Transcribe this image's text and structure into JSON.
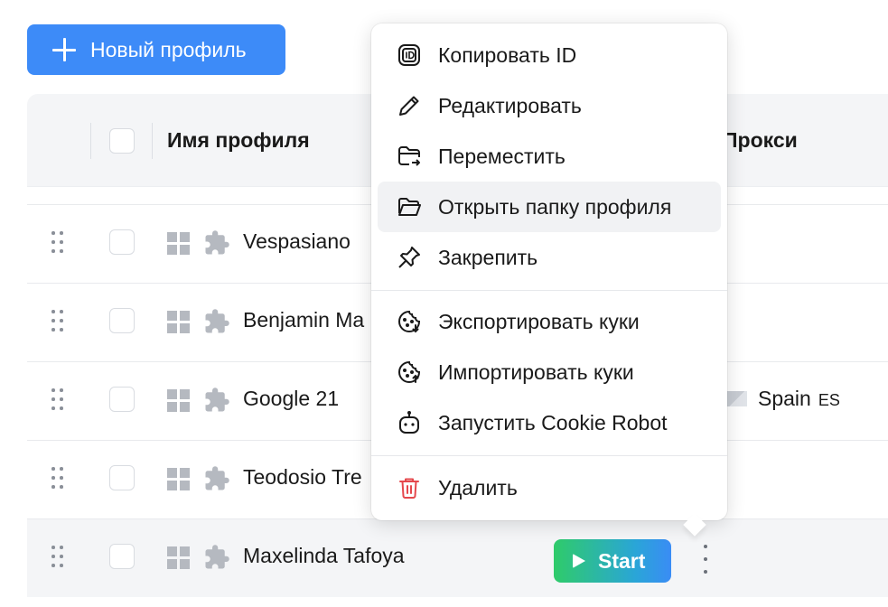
{
  "toolbar": {
    "new_profile_label": "Новый профиль"
  },
  "table": {
    "headers": {
      "name": "Имя профиля",
      "proxy": "Прокси"
    },
    "rows": [
      {
        "name": "Vespasiano",
        "proxy": "",
        "proxy_code": ""
      },
      {
        "name": "Benjamin Ma",
        "proxy": "",
        "proxy_code": ""
      },
      {
        "name": "Google 21",
        "proxy": "Spain",
        "proxy_code": "ES"
      },
      {
        "name": "Teodosio Tre",
        "proxy": "",
        "proxy_code": ""
      },
      {
        "name": "Maxelinda Tafoya",
        "proxy": "",
        "proxy_code": "",
        "start_label": "Start"
      }
    ]
  },
  "context_menu": {
    "items": [
      {
        "label": "Копировать ID",
        "icon": "id-icon"
      },
      {
        "label": "Редактировать",
        "icon": "pencil-icon"
      },
      {
        "label": "Переместить",
        "icon": "folder-move-icon"
      },
      {
        "label": "Открыть папку профиля",
        "icon": "folder-open-icon",
        "highlighted": true
      },
      {
        "label": "Закрепить",
        "icon": "pin-icon"
      },
      {
        "label": "Экспортировать куки",
        "icon": "cookie-export-icon"
      },
      {
        "label": "Импортировать куки",
        "icon": "cookie-import-icon"
      },
      {
        "label": "Запустить Cookie Robot",
        "icon": "robot-icon"
      },
      {
        "label": "Удалить",
        "icon": "trash-icon",
        "danger": true
      }
    ]
  },
  "colors": {
    "accent": "#3d8bf8",
    "danger": "#e5484d",
    "start_gradient_from": "#2fcb6a",
    "start_gradient_to": "#3a8cf5"
  }
}
